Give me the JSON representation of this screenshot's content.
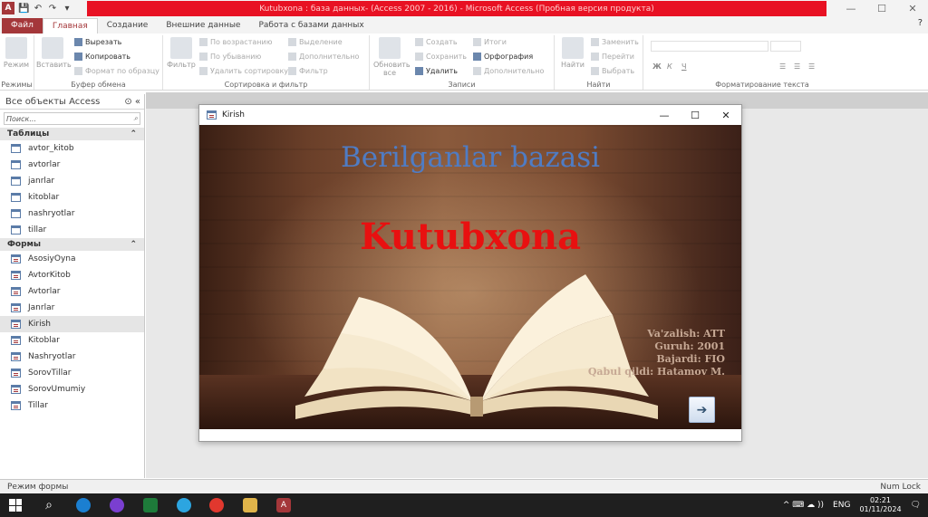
{
  "window": {
    "app_icon": "A",
    "title": "Kutubxona : база данных- (Access 2007 - 2016) - Microsoft Access (Пробная версия продукта)",
    "controls": [
      "—",
      "☐",
      "✕"
    ],
    "help_icon": "?"
  },
  "quick_access": {
    "save": "💾",
    "undo": "↶",
    "redo": "↷",
    "more": "▾"
  },
  "tabs": [
    {
      "label": "Файл"
    },
    {
      "label": "Главная"
    },
    {
      "label": "Создание"
    },
    {
      "label": "Внешние данные"
    },
    {
      "label": "Работа с базами данных"
    }
  ],
  "ribbon": {
    "groups": {
      "modes": "Режимы",
      "clipboard": "Буфер обмена",
      "sort_filter": "Сортировка и фильтр",
      "records": "Записи",
      "find": "Найти",
      "text_format": "Форматирование текста"
    },
    "buttons": {
      "mode": "Режим",
      "paste": "Вставить",
      "cut": "Вырезать",
      "copy": "Копировать",
      "format_painter": "Формат по образцу",
      "filter": "Фильтр",
      "sort_asc": "По возрастанию",
      "sort_desc": "По убыванию",
      "remove_sort": "Удалить сортировку",
      "selection": "Выделение",
      "advanced": "Дополнительно",
      "toggle_filter": "Фильтр",
      "refresh": "Обновить все",
      "new": "Создать",
      "save": "Сохранить",
      "delete": "Удалить",
      "totals": "Итоги",
      "spelling": "Орфография",
      "more": "Дополнительно",
      "find": "Найти",
      "replace": "Заменить",
      "goto": "Перейти",
      "select": "Выбрать"
    }
  },
  "nav": {
    "header": "Все объекты Access",
    "search_placeholder": "Поиск...",
    "tables_label": "Таблицы",
    "tables": [
      "avtor_kitob",
      "avtorlar",
      "janrlar",
      "kitoblar",
      "nashryotlar",
      "tillar"
    ],
    "forms_label": "Формы",
    "forms": [
      "AsosiyOyna",
      "AvtorKitob",
      "Avtorlar",
      "Janrlar",
      "Kirish",
      "Kitoblar",
      "Nashryotlar",
      "SorovTillar",
      "SorovUmumiy",
      "Tillar"
    ]
  },
  "form": {
    "title": "Kirish",
    "heading": "Berilganlar bazasi",
    "main_title": "Kutubxona",
    "info_lines": [
      "Va'zalish: ATT",
      "Guruh: 2001",
      "Bajardi: FIO",
      "Qabul qildi: Hatamov M."
    ],
    "next_icon": "➔"
  },
  "status": {
    "left": "Режим формы",
    "right": "Num Lock"
  },
  "taskbar": {
    "lang": "ENG",
    "time": "02:21",
    "date": "01/11/2024",
    "notification_icon": "🗨",
    "tray": "^  ⌨  ☁  )) "
  }
}
